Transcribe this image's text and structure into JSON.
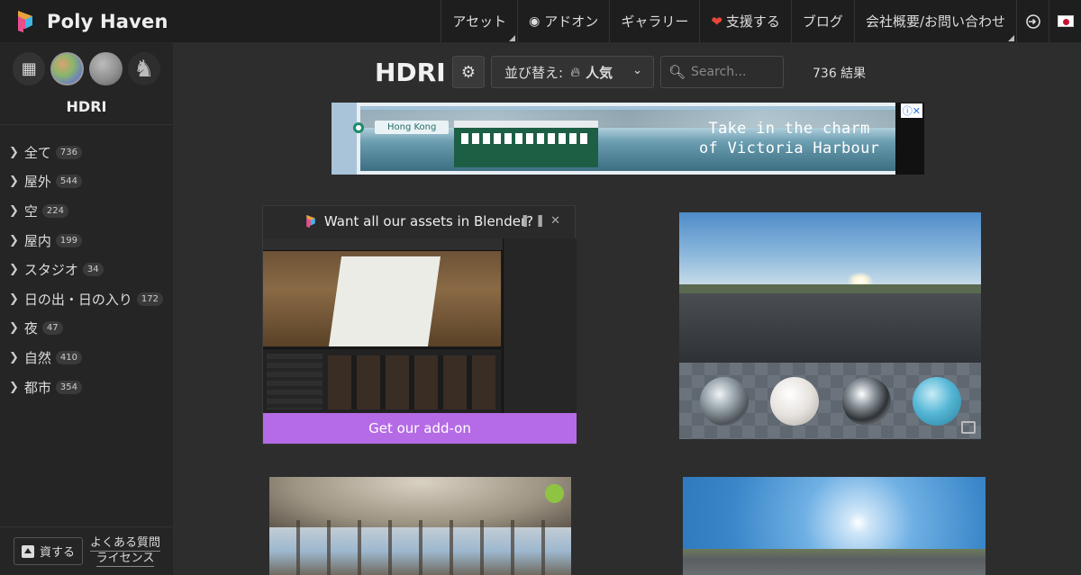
{
  "brand": {
    "name": "Poly Haven"
  },
  "nav": {
    "assets": "アセット",
    "addon": "アドオン",
    "gallery": "ギャラリー",
    "support": "支援する",
    "blog": "ブログ",
    "about": "会社概要/お問い合わせ"
  },
  "sidebar": {
    "title": "HDRI",
    "categories": [
      {
        "label": "全て",
        "count": "736"
      },
      {
        "label": "屋外",
        "count": "544"
      },
      {
        "label": "空",
        "count": "224"
      },
      {
        "label": "屋内",
        "count": "199"
      },
      {
        "label": "スタジオ",
        "count": "34"
      },
      {
        "label": "日の出・日の入り",
        "count": "172"
      },
      {
        "label": "夜",
        "count": "47"
      },
      {
        "label": "自然",
        "count": "410"
      },
      {
        "label": "都市",
        "count": "354"
      }
    ],
    "resources_label": "資する",
    "faq_label": "よくある質問",
    "license_label": "ライセンス"
  },
  "header": {
    "title": "HDRI",
    "sort_prefix": "並び替え:",
    "sort_value": "人気",
    "search_placeholder": "Search...",
    "results": "736 結果"
  },
  "ad": {
    "tag": "Hong Kong",
    "line1": "Take in the charm",
    "line2": "of Victoria Harbour"
  },
  "promo": {
    "title": "Want all our assets in Blender?",
    "cta": "Get our add-on"
  },
  "colors": {
    "accent_purple": "#b56be6",
    "new_badge": "#8fc443",
    "heart": "#e8463a"
  }
}
